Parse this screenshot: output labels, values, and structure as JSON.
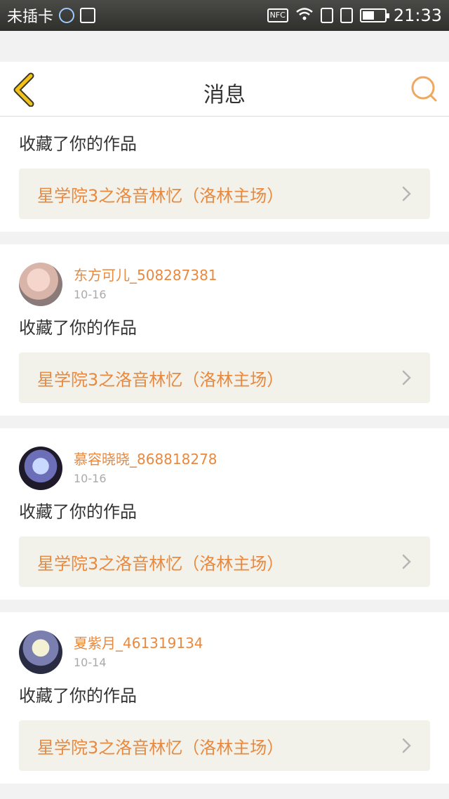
{
  "status_bar": {
    "carrier": "未插卡",
    "nfc_label": "NFC",
    "time": "21:33",
    "icons": [
      "qq-icon",
      "image-icon",
      "nfc-icon",
      "wifi-icon",
      "sim-icon",
      "sim-icon",
      "battery-icon"
    ]
  },
  "header": {
    "title": "消息",
    "back_icon": "chevron-left-icon",
    "search_icon": "search-icon",
    "accent_color": "#f3c21a",
    "search_color": "#f0a860"
  },
  "messages": [
    {
      "action": "收藏了你的作品",
      "work_title": "星学院3之洛音林忆（洛林主场）"
    },
    {
      "username": "东方可儿_508287381",
      "date": "10-16",
      "action": "收藏了你的作品",
      "work_title": "星学院3之洛音林忆（洛林主场）"
    },
    {
      "username": "慕容晓晓_868818278",
      "date": "10-16",
      "action": "收藏了你的作品",
      "work_title": "星学院3之洛音林忆（洛林主场）"
    },
    {
      "username": "夏紫月_461319134",
      "date": "10-14",
      "action": "收藏了你的作品",
      "work_title": "星学院3之洛音林忆（洛林主场）"
    }
  ],
  "colors": {
    "username": "#e8893f",
    "link_background": "#f3f2ea",
    "page_background": "#f2f2f2"
  }
}
